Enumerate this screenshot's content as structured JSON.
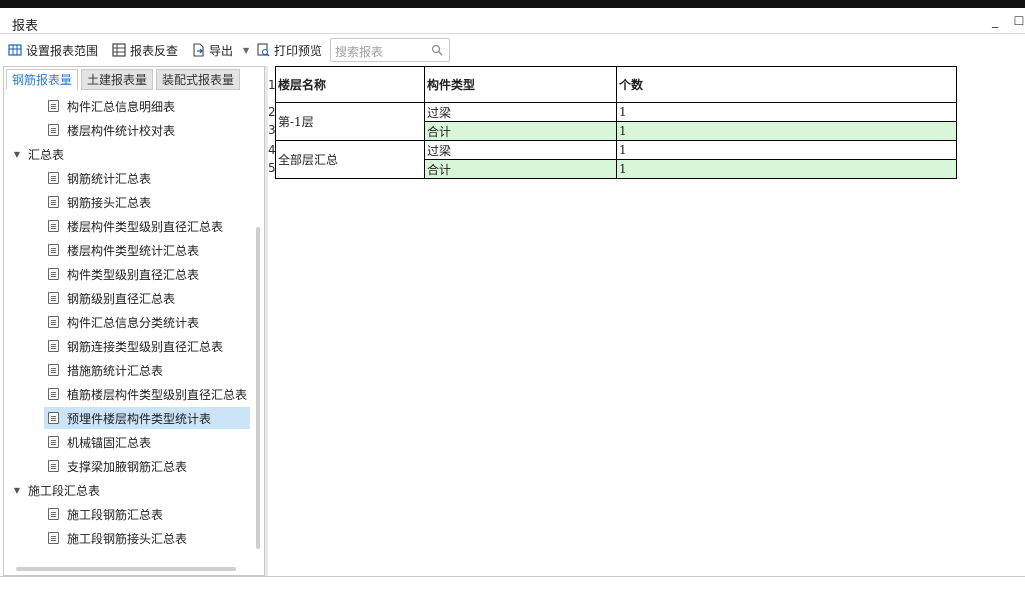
{
  "window": {
    "title": "报表",
    "minimize_glyph": "_",
    "maximize_glyph": "☐"
  },
  "toolbar": {
    "set_range_label": "设置报表范围",
    "reverse_check_label": "报表反查",
    "export_label": "导出",
    "print_preview_label": "打印预览"
  },
  "search": {
    "placeholder": "搜索报表"
  },
  "tabs": [
    {
      "label": "钢筋报表量"
    },
    {
      "label": "土建报表量"
    },
    {
      "label": "装配式报表量"
    }
  ],
  "tree": {
    "items": [
      {
        "label": "构件汇总信息明细表"
      },
      {
        "label": "楼层构件统计校对表"
      },
      {
        "label": "汇总表"
      },
      {
        "label": "钢筋统计汇总表"
      },
      {
        "label": "钢筋接头汇总表"
      },
      {
        "label": "楼层构件类型级别直径汇总表"
      },
      {
        "label": "楼层构件类型统计汇总表"
      },
      {
        "label": "构件类型级别直径汇总表"
      },
      {
        "label": "钢筋级别直径汇总表"
      },
      {
        "label": "构件汇总信息分类统计表"
      },
      {
        "label": "钢筋连接类型级别直径汇总表"
      },
      {
        "label": "措施筋统计汇总表"
      },
      {
        "label": "植筋楼层构件类型级别直径汇总表"
      },
      {
        "label": "预埋件楼层构件类型统计表"
      },
      {
        "label": "机械锚固汇总表"
      },
      {
        "label": "支撑梁加腋钢筋汇总表"
      },
      {
        "label": "施工段汇总表"
      },
      {
        "label": "施工段钢筋汇总表"
      },
      {
        "label": "施工段钢筋接头汇总表"
      }
    ]
  },
  "report": {
    "headers": [
      "楼层名称",
      "构件类型",
      "个数"
    ],
    "row_numbers": [
      "1",
      "2",
      "3",
      "4",
      "5"
    ],
    "groups": [
      {
        "floor": "第-1层",
        "rows": [
          {
            "type": "过梁",
            "count": "1"
          },
          {
            "type": "合计",
            "count": "1"
          }
        ]
      },
      {
        "floor": "全部层汇总",
        "rows": [
          {
            "type": "过梁",
            "count": "1"
          },
          {
            "type": "合计",
            "count": "1"
          }
        ]
      }
    ],
    "total_row_color": "#d8f7d8"
  },
  "colors": {
    "accent": "#2b7bd6",
    "selected_row": "#cce4f7"
  }
}
